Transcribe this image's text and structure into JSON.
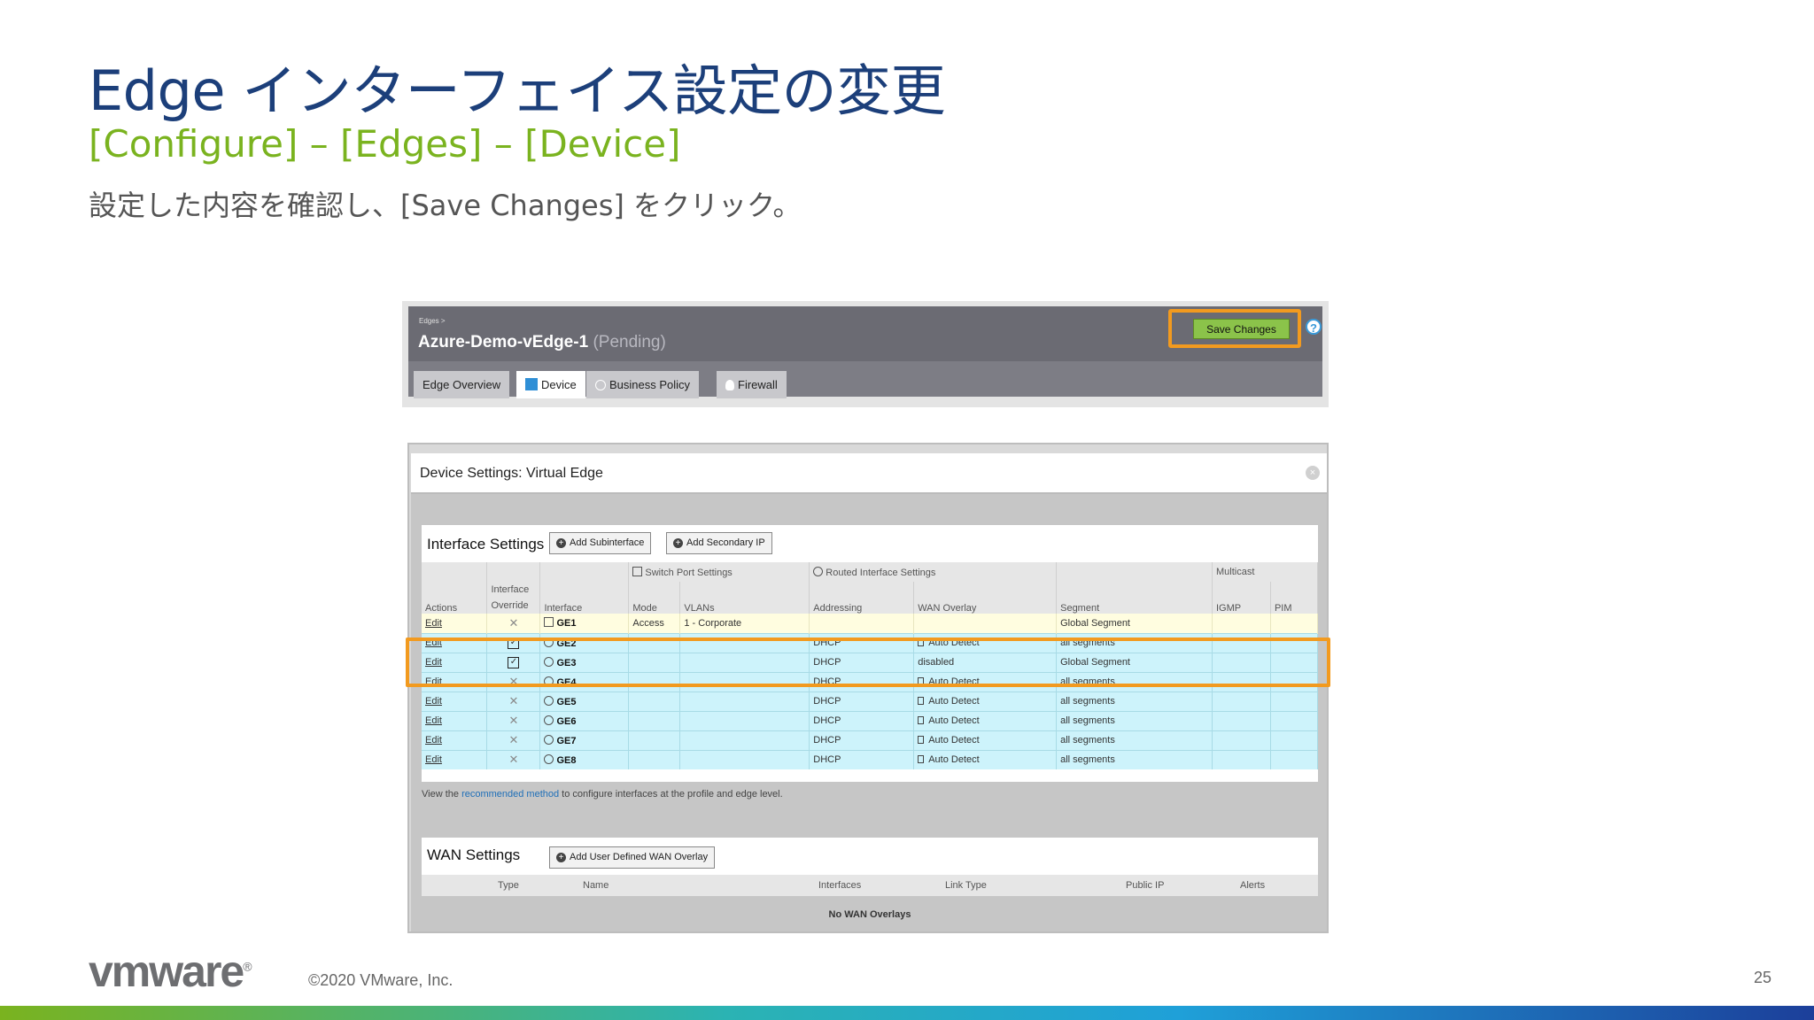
{
  "slide": {
    "title": "Edge インターフェイス設定の変更",
    "subtitle": "[Configure] – [Edges] – [Device]",
    "description": "設定した内容を確認し、[Save Changes] をクリック。",
    "logo": "vmware",
    "copyright": "©2020 VMware, Inc.",
    "page_number": "25"
  },
  "edge": {
    "breadcrumb": "Edges >",
    "name": "Azure-Demo-vEdge-1",
    "status": "(Pending)",
    "save_label": "Save Changes",
    "help": "?",
    "tabs": [
      "Edge Overview",
      "Device",
      "Business Policy",
      "Firewall"
    ],
    "active_tab": "Device"
  },
  "device": {
    "title": "Device Settings: Virtual Edge",
    "interface_settings": {
      "title": "Interface Settings",
      "add_subinterface": "Add Subinterface",
      "add_secondary_ip": "Add Secondary IP",
      "groups": {
        "switch_port": "Switch Port Settings",
        "routed": "Routed Interface Settings",
        "multicast": "Multicast"
      },
      "columns": {
        "actions": "Actions",
        "override_top": "Interface",
        "override_bottom": "Override",
        "interface": "Interface",
        "mode": "Mode",
        "vlans": "VLANs",
        "addressing": "Addressing",
        "wan_overlay": "WAN Overlay",
        "segment": "Segment",
        "igmp": "IGMP",
        "pim": "PIM"
      },
      "rows": [
        {
          "action": "Edit",
          "override": "✕",
          "interface": "GE1",
          "mode": "Access",
          "vlans": "1 - Corporate",
          "addressing": "",
          "wan": "",
          "segment": "Global Segment"
        },
        {
          "action": "Edit",
          "override": "✓",
          "interface": "GE2",
          "mode": "",
          "vlans": "",
          "addressing": "DHCP",
          "wan": "Auto Detect",
          "segment": "all segments"
        },
        {
          "action": "Edit",
          "override": "✓",
          "interface": "GE3",
          "mode": "",
          "vlans": "",
          "addressing": "DHCP",
          "wan": "disabled",
          "segment": "Global Segment"
        },
        {
          "action": "Edit",
          "override": "✕",
          "interface": "GE4",
          "mode": "",
          "vlans": "",
          "addressing": "DHCP",
          "wan": "Auto Detect",
          "segment": "all segments"
        },
        {
          "action": "Edit",
          "override": "✕",
          "interface": "GE5",
          "mode": "",
          "vlans": "",
          "addressing": "DHCP",
          "wan": "Auto Detect",
          "segment": "all segments"
        },
        {
          "action": "Edit",
          "override": "✕",
          "interface": "GE6",
          "mode": "",
          "vlans": "",
          "addressing": "DHCP",
          "wan": "Auto Detect",
          "segment": "all segments"
        },
        {
          "action": "Edit",
          "override": "✕",
          "interface": "GE7",
          "mode": "",
          "vlans": "",
          "addressing": "DHCP",
          "wan": "Auto Detect",
          "segment": "all segments"
        },
        {
          "action": "Edit",
          "override": "✕",
          "interface": "GE8",
          "mode": "",
          "vlans": "",
          "addressing": "DHCP",
          "wan": "Auto Detect",
          "segment": "all segments"
        }
      ],
      "note_prefix": "View the ",
      "note_link": "recommended method",
      "note_suffix": " to configure interfaces at the profile and edge level."
    },
    "wan_settings": {
      "title": "WAN Settings",
      "add_overlay": "Add User Defined WAN Overlay",
      "columns": [
        "Type",
        "Name",
        "Interfaces",
        "Link Type",
        "Public IP",
        "Alerts"
      ],
      "empty": "No WAN Overlays"
    }
  },
  "colors": {
    "title_blue": "#1c3f7a",
    "subtitle_green": "#7ab31f",
    "highlight_orange": "#f29a1f",
    "save_green": "#8bc34a",
    "row_cyan": "#cdf3fb",
    "row_yellow": "#fffde0"
  }
}
